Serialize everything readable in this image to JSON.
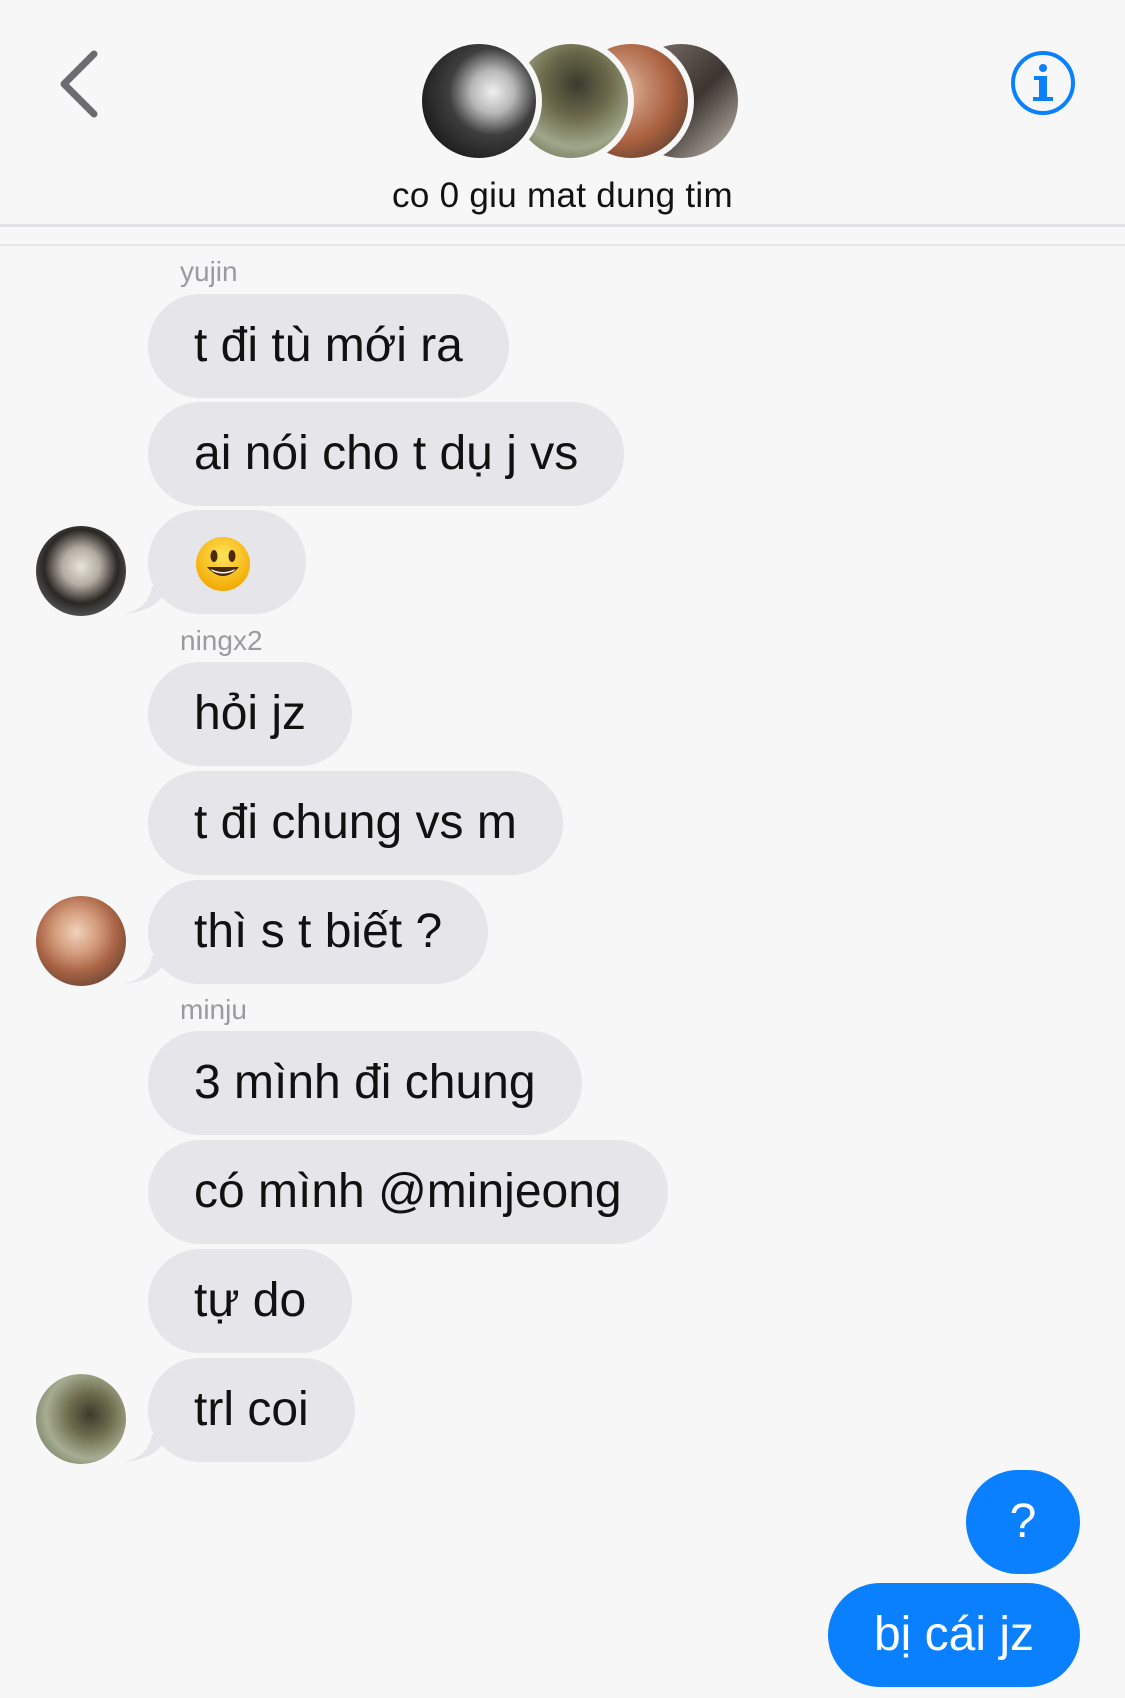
{
  "header": {
    "title": "co 0 giu mat dung tim",
    "back_icon": "chevron-left-icon",
    "info_icon": "info-icon",
    "accent": "#0a80ff"
  },
  "messages": [
    {
      "sender": "yujin",
      "lines": [
        "t đi tù mới ra",
        "ai nói cho t dụ j vs",
        "😃"
      ]
    },
    {
      "sender": "ningx2",
      "lines": [
        "hỏi jz",
        "t đi chung vs m",
        "thì s t biết ?"
      ]
    },
    {
      "sender": "minju",
      "lines": [
        "3 mình đi chung",
        "có mình @minjeong",
        "tự do",
        "trl coi"
      ]
    }
  ],
  "outgoing": [
    "?",
    "bị cái jz"
  ],
  "colors": {
    "incoming_bubble": "#e5e5ea",
    "outgoing_bubble": "#0a80ff",
    "sender_label": "#9a9a9f",
    "background": "#f7f7f8"
  }
}
